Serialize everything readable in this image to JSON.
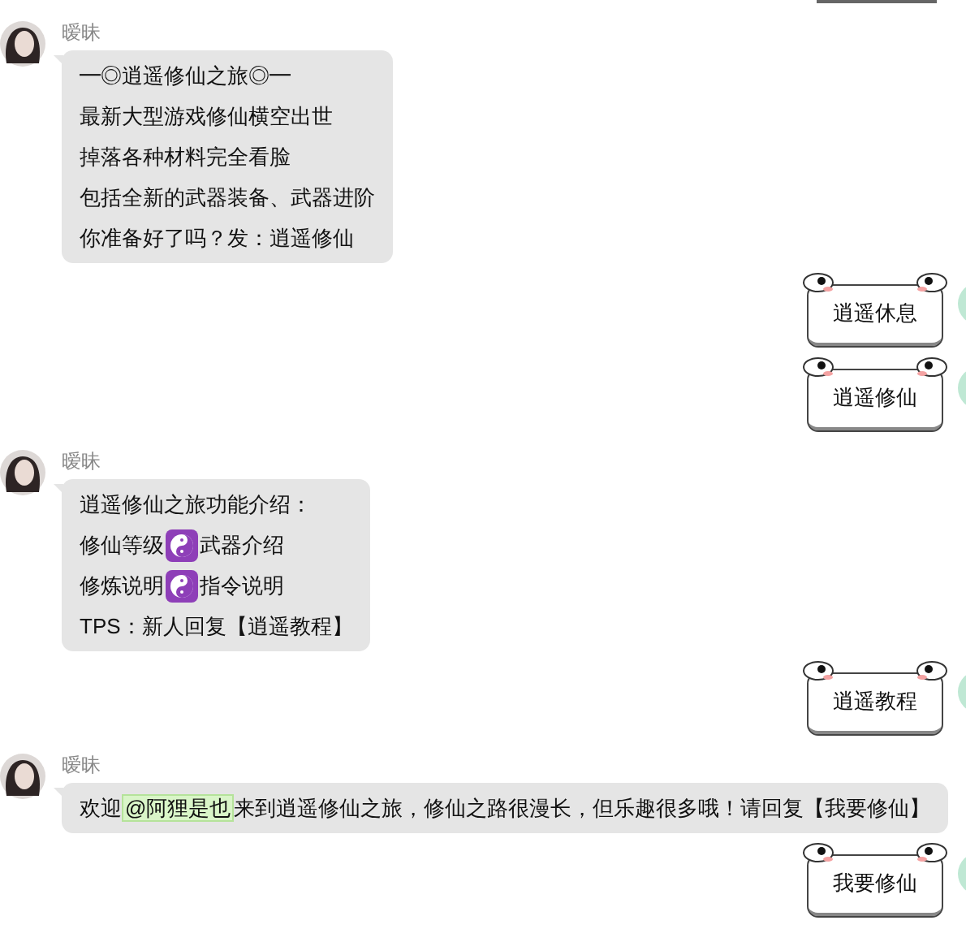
{
  "messages": [
    {
      "kind": "incoming",
      "name": "暧昧",
      "lines": [
        {
          "kind": "plain",
          "text": "━◎逍遥修仙之旅◎━"
        },
        {
          "kind": "plain",
          "text": "最新大型游戏修仙横空出世"
        },
        {
          "kind": "plain",
          "text": "掉落各种材料完全看脸"
        },
        {
          "kind": "plain",
          "text": "包括全新的武器装备、武器进阶"
        },
        {
          "kind": "plain",
          "text": "你准备好了吗？发：逍遥修仙"
        }
      ]
    },
    {
      "kind": "outgoing",
      "sticker": "逍遥休息"
    },
    {
      "kind": "outgoing",
      "sticker": "逍遥修仙"
    },
    {
      "kind": "incoming",
      "name": "暧昧",
      "lines": [
        {
          "kind": "plain",
          "text": "逍遥修仙之旅功能介绍："
        },
        {
          "kind": "icon",
          "parts": [
            "修仙等级",
            "武器介绍"
          ]
        },
        {
          "kind": "icon",
          "parts": [
            "修炼说明",
            "指令说明"
          ]
        },
        {
          "kind": "plain",
          "text": "TPS：新人回复【逍遥教程】"
        }
      ]
    },
    {
      "kind": "outgoing",
      "sticker": "逍遥教程"
    },
    {
      "kind": "incoming",
      "name": "暧昧",
      "lines": [
        {
          "kind": "mention",
          "before": "欢迎",
          "mention": "@阿狸是也",
          "after": "来到逍遥修仙之旅，修仙之路很漫长，但乐趣很多哦！请回复【我要修仙】"
        }
      ]
    },
    {
      "kind": "outgoing",
      "sticker": "我要修仙"
    }
  ]
}
